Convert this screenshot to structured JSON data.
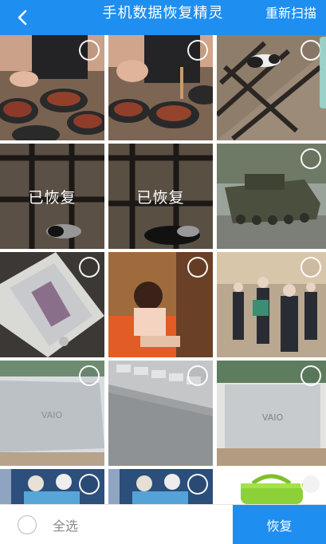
{
  "header": {
    "back_icon": "chevron-left-icon",
    "title": "手机数据恢复精灵",
    "rescan_label": "重新扫描",
    "accent_color": "#1e8ff0"
  },
  "grid": {
    "recovered_label": "已恢复",
    "photos": [
      {
        "subject": "steak dinner",
        "status": "unselected"
      },
      {
        "subject": "steak dinner",
        "status": "unselected"
      },
      {
        "subject": "cat on grate",
        "status": "unselected"
      },
      {
        "subject": "cat on grate",
        "status": "recovered"
      },
      {
        "subject": "cat on grate",
        "status": "recovered"
      },
      {
        "subject": "tank",
        "status": "unselected"
      },
      {
        "subject": "smartphone",
        "status": "unselected"
      },
      {
        "subject": "girl on sofa",
        "status": "unselected"
      },
      {
        "subject": "crowd in hall",
        "status": "unselected"
      },
      {
        "subject": "vaio laptop",
        "status": "unselected"
      },
      {
        "subject": "laptop keyboard",
        "status": "unselected"
      },
      {
        "subject": "vaio laptop",
        "status": "unselected"
      },
      {
        "subject": "game art",
        "status": "unselected"
      },
      {
        "subject": "game art",
        "status": "unselected"
      },
      {
        "subject": "green bag",
        "status": "unselected"
      }
    ]
  },
  "footer": {
    "select_all_label": "全选",
    "recover_label": "恢复"
  }
}
